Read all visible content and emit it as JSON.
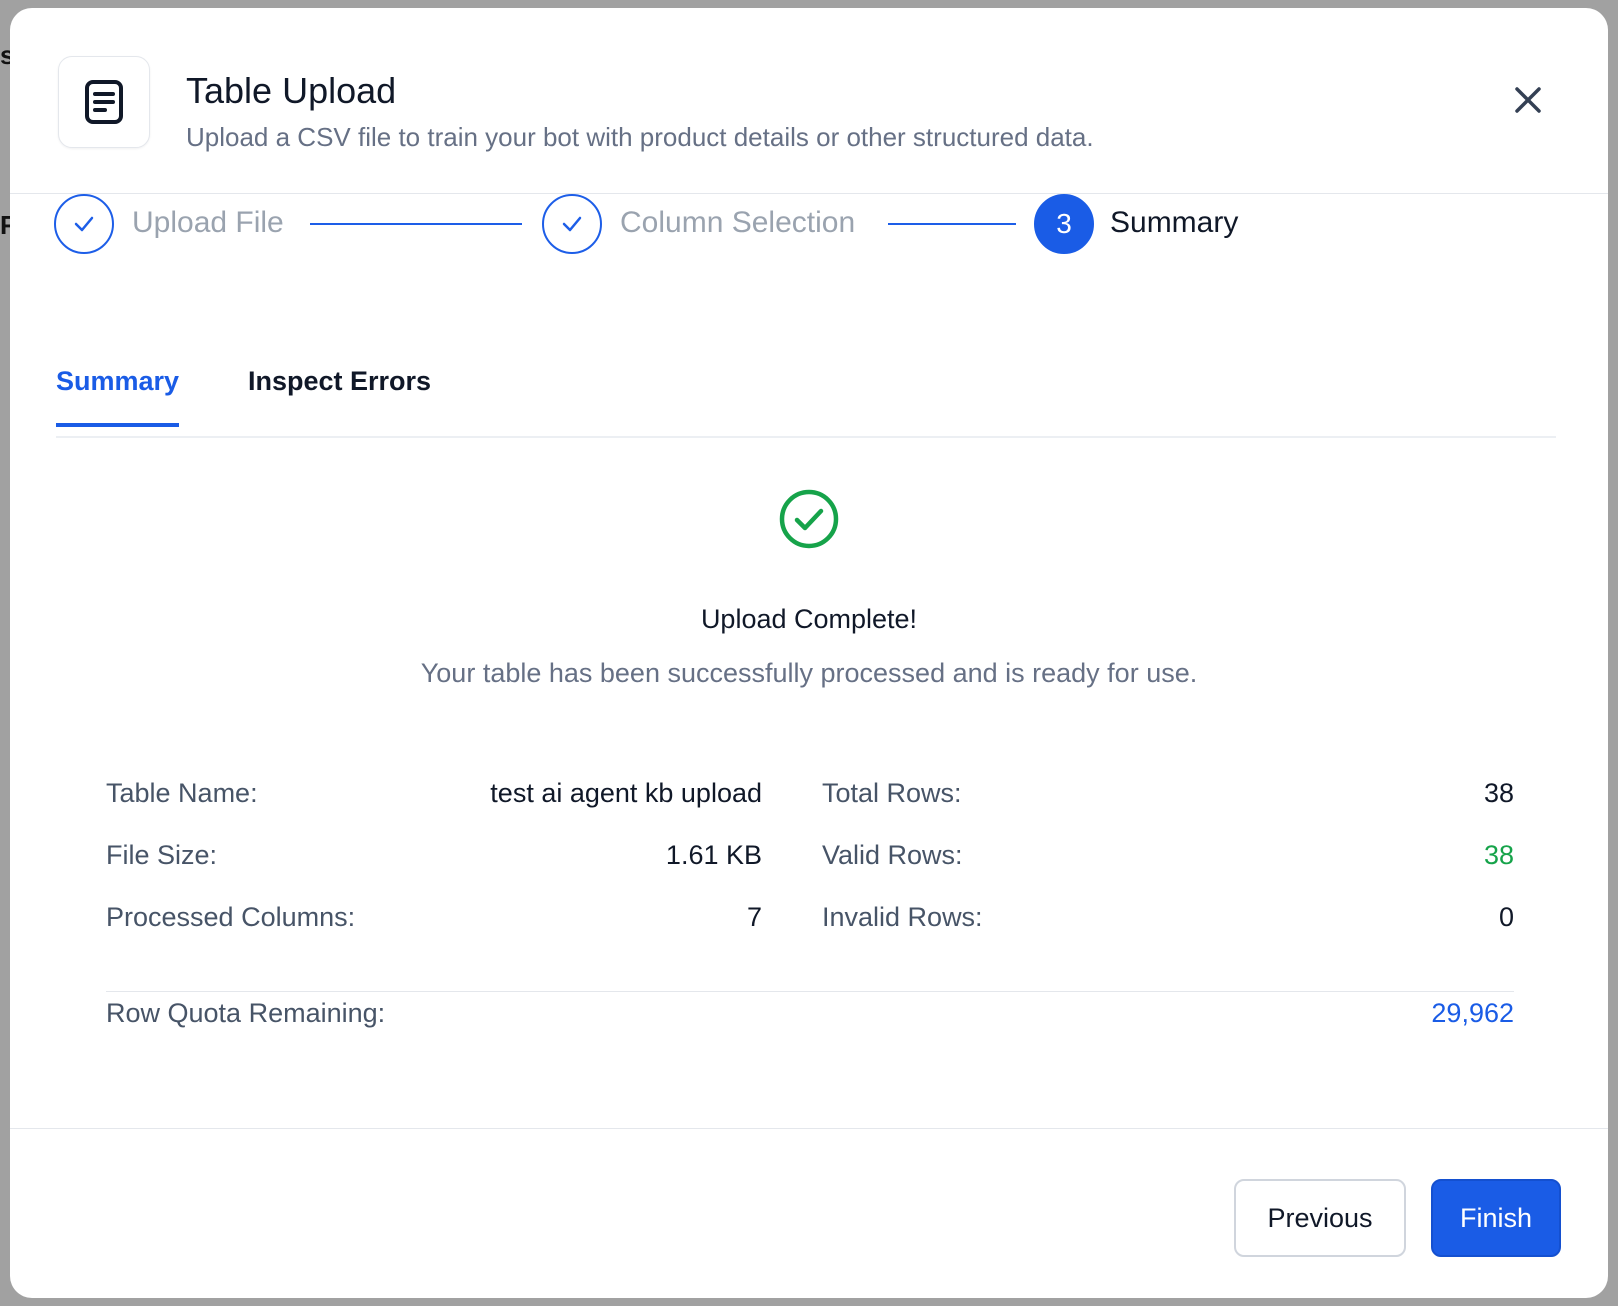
{
  "backdrop": {
    "fragment_top": "s",
    "fragment_mid": "F"
  },
  "header": {
    "title": "Table Upload",
    "subtitle": "Upload a CSV file to train your bot with product details or other structured data.",
    "icon": "document-icon",
    "close_icon": "close-icon"
  },
  "stepper": {
    "steps": [
      {
        "label": "Upload File",
        "state": "complete"
      },
      {
        "label": "Column Selection",
        "state": "complete"
      },
      {
        "number": "3",
        "label": "Summary",
        "state": "active"
      }
    ]
  },
  "tabs": [
    {
      "label": "Summary",
      "active": true
    },
    {
      "label": "Inspect Errors",
      "active": false
    }
  ],
  "result": {
    "title": "Upload Complete!",
    "message": "Your table has been successfully processed and is ready for use."
  },
  "stats": {
    "table_name_label": "Table Name:",
    "table_name_value": "test ai agent kb upload",
    "file_size_label": "File Size:",
    "file_size_value": "1.61 KB",
    "processed_columns_label": "Processed Columns:",
    "processed_columns_value": "7",
    "total_rows_label": "Total Rows:",
    "total_rows_value": "38",
    "valid_rows_label": "Valid Rows:",
    "valid_rows_value": "38",
    "invalid_rows_label": "Invalid Rows:",
    "invalid_rows_value": "0",
    "quota_label": "Row Quota Remaining:",
    "quota_value": "29,962"
  },
  "footer": {
    "previous_label": "Previous",
    "finish_label": "Finish"
  },
  "colors": {
    "accent": "#1a5ce6",
    "success": "#16a34a",
    "muted": "#667085",
    "text": "#101828"
  }
}
